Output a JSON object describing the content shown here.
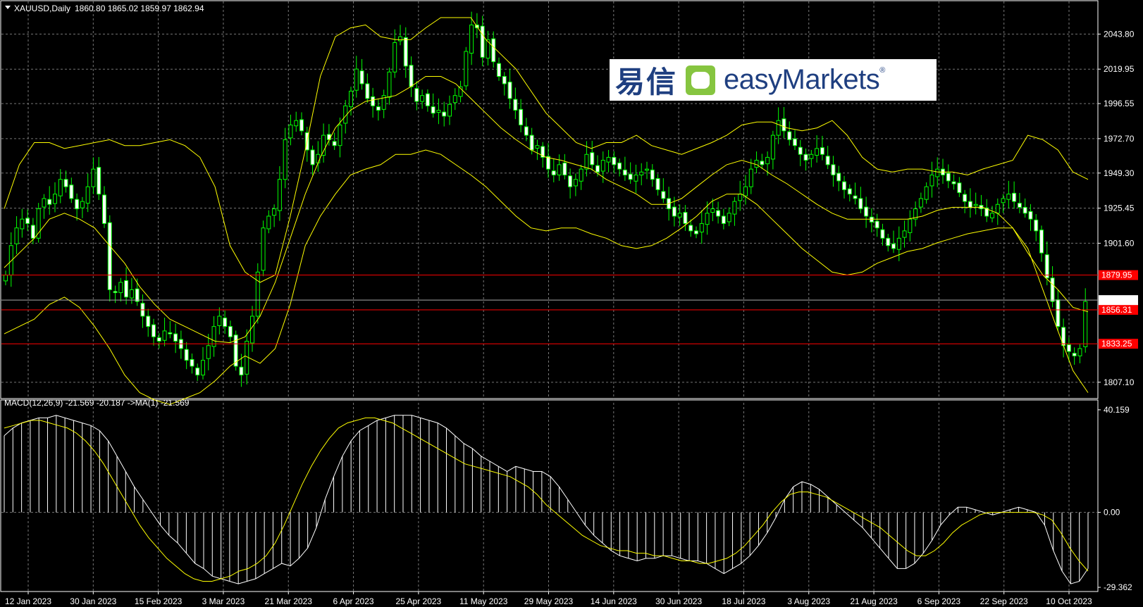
{
  "header": {
    "symbol_info": "XAUUSD,Daily",
    "ohlc": "1860.80 1865.02 1859.97 1862.94"
  },
  "indicator_header": "MACD(12,26,9) -21.569 -20.187  ->MA(1) -21.569",
  "logo": {
    "chinese": "易信",
    "english": "easyMarkets",
    "registered": "®"
  },
  "colors": {
    "background": "#000000",
    "candle": "#00ff00",
    "bullish_body": "#000000",
    "bearish_body": "#ffffff",
    "bollinger": "#ffff00",
    "level_line": "#ff0000",
    "macd_hist": "#ffffff",
    "signal": "#ffff00"
  },
  "chart_data": {
    "type": "line",
    "title": "XAUUSD,Daily",
    "price_axis": {
      "ticks": [
        "2043.80",
        "2019.95",
        "1996.55",
        "1972.70",
        "1949.30",
        "1925.45",
        "1901.60",
        "1807.10"
      ],
      "ylim": [
        1796,
        2066
      ]
    },
    "x_ticks": [
      "12 Jan 2023",
      "30 Jan 2023",
      "15 Feb 2023",
      "3 Mar 2023",
      "21 Mar 2023",
      "6 Apr 2023",
      "25 Apr 2023",
      "11 May 2023",
      "29 May 2023",
      "14 Jun 2023",
      "30 Jun 2023",
      "18 Jul 2023",
      "3 Aug 2023",
      "21 Aug 2023",
      "6 Sep 2023",
      "22 Sep 2023",
      "10 Oct 2023"
    ],
    "levels": [
      {
        "value": 1879.95,
        "label": "1879.95",
        "color": "#ff0000"
      },
      {
        "value": 1856.31,
        "label": "1856.31",
        "color": "#ff0000"
      },
      {
        "value": 1833.25,
        "label": "1833.25",
        "color": "#ff0000"
      }
    ],
    "current_price": {
      "value": 1862.94,
      "label": "1862.94"
    },
    "close_series": [
      1880,
      1900,
      1912,
      1918,
      1915,
      1905,
      1925,
      1932,
      1928,
      1935,
      1945,
      1940,
      1932,
      1925,
      1930,
      1940,
      1952,
      1935,
      1915,
      1870,
      1868,
      1875,
      1865,
      1870,
      1862,
      1852,
      1845,
      1838,
      1835,
      1842,
      1840,
      1835,
      1830,
      1822,
      1818,
      1812,
      1822,
      1832,
      1845,
      1852,
      1845,
      1838,
      1818,
      1812,
      1835,
      1852,
      1882,
      1912,
      1920,
      1925,
      1945,
      1972,
      1982,
      1985,
      1978,
      1965,
      1955,
      1962,
      1975,
      1972,
      1968,
      1982,
      1995,
      2005,
      2020,
      2010,
      2000,
      1995,
      1992,
      2002,
      2018,
      2038,
      2042,
      2022,
      2008,
      1998,
      2002,
      1995,
      1990,
      1992,
      1988,
      1996,
      2002,
      2008,
      2032,
      2050,
      2048,
      2028,
      2040,
      2025,
      2015,
      2010,
      2000,
      1992,
      1982,
      1975,
      1965,
      1968,
      1960,
      1952,
      1948,
      1955,
      1948,
      1940,
      1945,
      1952,
      1962,
      1955,
      1950,
      1958,
      1960,
      1955,
      1952,
      1948,
      1945,
      1948,
      1950,
      1952,
      1945,
      1938,
      1932,
      1925,
      1920,
      1922,
      1915,
      1910,
      1908,
      1915,
      1922,
      1925,
      1920,
      1915,
      1922,
      1930,
      1935,
      1940,
      1952,
      1958,
      1955,
      1960,
      1975,
      1985,
      1978,
      1972,
      1968,
      1962,
      1958,
      1962,
      1966,
      1962,
      1955,
      1948,
      1944,
      1938,
      1935,
      1932,
      1925,
      1920,
      1916,
      1912,
      1905,
      1900,
      1898,
      1905,
      1910,
      1918,
      1925,
      1932,
      1940,
      1948,
      1952,
      1948,
      1944,
      1942,
      1936,
      1930,
      1926,
      1928,
      1925,
      1920,
      1922,
      1928,
      1932,
      1935,
      1930,
      1926,
      1922,
      1918,
      1910,
      1895,
      1878,
      1862,
      1845,
      1832,
      1828,
      1825,
      1830,
      1862
    ],
    "bollinger": {
      "upper": [
        1925,
        1955,
        1970,
        1970,
        1966,
        1968,
        1970,
        1972,
        1968,
        1968,
        1970,
        1972,
        1968,
        1960,
        1940,
        1900,
        1882,
        1875,
        1880,
        1920,
        1965,
        2015,
        2042,
        2048,
        2050,
        2042,
        2040,
        2040,
        2048,
        2055,
        2055,
        2055,
        2040,
        2030,
        2020,
        2005,
        1990,
        1980,
        1970,
        1966,
        1970,
        1970,
        1975,
        1968,
        1965,
        1962,
        1966,
        1970,
        1975,
        1982,
        1984,
        1984,
        1980,
        1978,
        1980,
        1985,
        1975,
        1960,
        1952,
        1950,
        1952,
        1952,
        1950,
        1950,
        1948,
        1952,
        1955,
        1958,
        1975,
        1972,
        1965,
        1950,
        1945
      ],
      "middle": [
        1885,
        1895,
        1905,
        1918,
        1922,
        1918,
        1912,
        1900,
        1888,
        1872,
        1860,
        1850,
        1845,
        1840,
        1835,
        1834,
        1838,
        1852,
        1875,
        1905,
        1935,
        1960,
        1980,
        1992,
        1998,
        2000,
        2002,
        2008,
        2015,
        2015,
        2010,
        2000,
        1990,
        1980,
        1972,
        1965,
        1960,
        1958,
        1955,
        1952,
        1945,
        1940,
        1935,
        1928,
        1928,
        1932,
        1940,
        1948,
        1955,
        1958,
        1955,
        1948,
        1942,
        1935,
        1928,
        1922,
        1918,
        1918,
        1918,
        1918,
        1918,
        1920,
        1924,
        1926,
        1926,
        1926,
        1922,
        1912,
        1895,
        1880,
        1870,
        1858,
        1855
      ],
      "lower": [
        1840,
        1845,
        1850,
        1860,
        1865,
        1858,
        1845,
        1830,
        1812,
        1800,
        1795,
        1792,
        1796,
        1800,
        1808,
        1818,
        1825,
        1820,
        1830,
        1860,
        1900,
        1920,
        1935,
        1948,
        1952,
        1955,
        1962,
        1962,
        1965,
        1962,
        1955,
        1948,
        1940,
        1930,
        1920,
        1912,
        1910,
        1912,
        1912,
        1908,
        1905,
        1900,
        1898,
        1900,
        1905,
        1912,
        1920,
        1930,
        1935,
        1935,
        1928,
        1918,
        1908,
        1898,
        1890,
        1882,
        1880,
        1882,
        1888,
        1892,
        1896,
        1898,
        1902,
        1905,
        1908,
        1910,
        1912,
        1912,
        1898,
        1870,
        1842,
        1815,
        1800
      ]
    },
    "macd": {
      "axis_ticks": [
        "40.159",
        "0.00",
        "-29.362"
      ],
      "ylim": [
        -31,
        44
      ],
      "histogram": [
        30,
        33,
        35,
        36,
        37,
        37,
        38,
        37,
        36,
        35,
        34,
        32,
        28,
        22,
        16,
        10,
        5,
        0,
        -5,
        -9,
        -12,
        -16,
        -20,
        -22,
        -25,
        -26,
        -27,
        -28,
        -27,
        -26,
        -24,
        -22,
        -20,
        -21,
        -18,
        -14,
        -6,
        5,
        14,
        22,
        28,
        32,
        34,
        36,
        37,
        38,
        38,
        38,
        37,
        36,
        35,
        33,
        30,
        27,
        25,
        22,
        20,
        18,
        16,
        18,
        17,
        16,
        16,
        14,
        10,
        5,
        0,
        -5,
        -9,
        -12,
        -15,
        -17,
        -18,
        -19,
        -18,
        -18,
        -17,
        -17,
        -18,
        -19,
        -19,
        -20,
        -22,
        -24,
        -22,
        -20,
        -17,
        -13,
        -8,
        -2,
        5,
        10,
        12,
        11,
        9,
        6,
        3,
        0,
        -3,
        -6,
        -10,
        -14,
        -18,
        -22,
        -22,
        -20,
        -16,
        -11,
        -5,
        -1,
        2,
        2,
        1,
        0,
        -1,
        0,
        1,
        2,
        1,
        0,
        -5,
        -15,
        -23,
        -28,
        -27,
        -22
      ],
      "signal": [
        33,
        34,
        35,
        36,
        36,
        35,
        34,
        33,
        31,
        28,
        24,
        19,
        13,
        7,
        1,
        -5,
        -10,
        -14,
        -18,
        -21,
        -24,
        -26,
        -27,
        -27,
        -26,
        -25,
        -23,
        -22,
        -20,
        -17,
        -12,
        -5,
        3,
        11,
        18,
        24,
        29,
        33,
        35,
        36,
        37,
        37,
        36,
        35,
        33,
        31,
        29,
        27,
        25,
        23,
        21,
        19,
        18,
        17,
        16,
        15,
        14,
        12,
        10,
        7,
        3,
        0,
        -3,
        -6,
        -9,
        -11,
        -13,
        -14,
        -15,
        -15,
        -16,
        -16,
        -17,
        -17,
        -18,
        -19,
        -19,
        -20,
        -20,
        -19,
        -18,
        -16,
        -13,
        -9,
        -5,
        0,
        4,
        7,
        8,
        8,
        7,
        6,
        4,
        2,
        0,
        -2,
        -4,
        -6,
        -9,
        -12,
        -15,
        -17,
        -17,
        -15,
        -12,
        -8,
        -5,
        -3,
        -1,
        0,
        0,
        0,
        0,
        0,
        0,
        -1,
        -3,
        -8,
        -14,
        -19,
        -23
      ]
    }
  }
}
